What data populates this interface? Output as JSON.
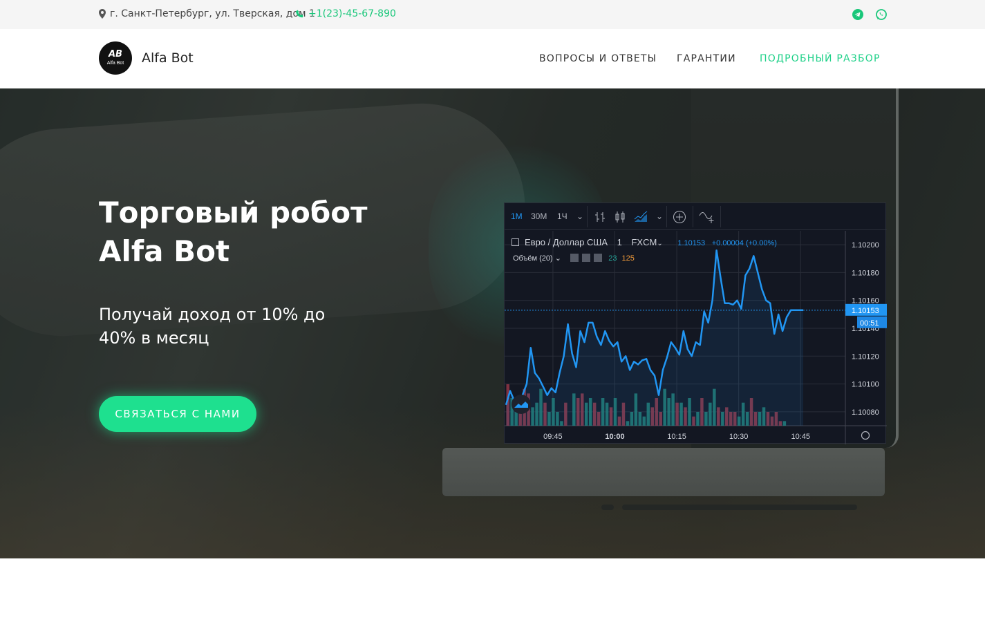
{
  "topbar": {
    "address": "г. Санкт-Петербург, ул. Тверская, дом 1",
    "phone": "+1(23)-45-67-890",
    "icons": [
      "location-pin-icon",
      "phone-icon",
      "telegram-icon",
      "whatsapp-icon"
    ]
  },
  "header": {
    "logo_mark": "AB",
    "logo_text": "Alfa Bot",
    "brand": "Alfa Bot",
    "nav": [
      {
        "label": "ВОПРОСЫ И ОТВЕТЫ",
        "active": false
      },
      {
        "label": "ГАРАНТИИ",
        "active": false
      },
      {
        "label": "ПОДРОБНЫЙ РАЗБОР",
        "active": true
      }
    ]
  },
  "hero": {
    "title_line1": "Торговый робот",
    "title_line2": "Alfa Bot",
    "subtitle": "Получай доход от 10% до 40% в месяц",
    "cta": "СВЯЗАТЬСЯ С НАМИ"
  },
  "colors": {
    "accent": "#1ee08f",
    "chart_line": "#2196f3",
    "chart_bg": "#131722"
  },
  "widget": {
    "timeframes": [
      "1М",
      "30М",
      "1Ч"
    ],
    "active_timeframe": "1М",
    "symbol": "Евро / Доллар США",
    "interval": "1",
    "exchange": "FXCM",
    "last_price": "1.10153",
    "change": "+0.00004 (+0.00%)",
    "volume_label": "Объём (20)",
    "volume_a": "23",
    "volume_b": "125",
    "price_tag": "1.10153",
    "timer_tag": "00:51"
  },
  "chart_data": {
    "type": "line",
    "ylim": [
      1.1007,
      1.1021
    ],
    "yticks": [
      "1.10200",
      "1.10180",
      "1.10160",
      "1.10140",
      "1.10120",
      "1.10100",
      "1.10080"
    ],
    "xticks": [
      "09:45",
      "10:00",
      "10:15",
      "10:30",
      "10:45"
    ],
    "bold_xtick": "10:00",
    "x": [
      0,
      1,
      2,
      3,
      4,
      5,
      6,
      7,
      8,
      9,
      10,
      11,
      12,
      13,
      14,
      15,
      16,
      17,
      18,
      19,
      20,
      21,
      22,
      23,
      24,
      25,
      26,
      27,
      28,
      29,
      30,
      31,
      32,
      33,
      34,
      35,
      36,
      37,
      38,
      39,
      40,
      41,
      42,
      43,
      44,
      45,
      46,
      47,
      48,
      49,
      50,
      51,
      52,
      53,
      54,
      55,
      56,
      57,
      58,
      59,
      60,
      61,
      62,
      63,
      64,
      65,
      66,
      67,
      68,
      69,
      70,
      71,
      72
    ],
    "series": [
      {
        "values": [
          1.10085,
          1.10095,
          1.10088,
          1.10082,
          1.10092,
          1.101,
          1.10126,
          1.10108,
          1.10104,
          1.10098,
          1.10092,
          1.10097,
          1.10094,
          1.10108,
          1.1012,
          1.10143,
          1.10122,
          1.10112,
          1.10138,
          1.1013,
          1.10144,
          1.10144,
          1.10134,
          1.10128,
          1.10138,
          1.10131,
          1.10127,
          1.1013,
          1.10116,
          1.1012,
          1.1011,
          1.10116,
          1.10114,
          1.10117,
          1.10118,
          1.1011,
          1.10106,
          1.10092,
          1.1011,
          1.10119,
          1.1013,
          1.10126,
          1.10121,
          1.10138,
          1.10125,
          1.1012,
          1.1013,
          1.10128,
          1.10152,
          1.10144,
          1.1016,
          1.10196,
          1.10176,
          1.10158,
          1.10158,
          1.10157,
          1.1016,
          1.10154,
          1.10178,
          1.10183,
          1.10192,
          1.1018,
          1.10168,
          1.1016,
          1.10158,
          1.10136,
          1.1015,
          1.10138,
          1.10148,
          1.10153,
          1.10153,
          1.10153,
          1.10153
        ],
        "up_volume": [
          0,
          6,
          3,
          0,
          0,
          1,
          4,
          5,
          8,
          1,
          3,
          6,
          3,
          1,
          4,
          0,
          7,
          2,
          3,
          5,
          6,
          2,
          1,
          6,
          5,
          0,
          6,
          0,
          3,
          1,
          3,
          7,
          3,
          2,
          5,
          0,
          0,
          0,
          8,
          6,
          7,
          0,
          5,
          0,
          6,
          0,
          3,
          0,
          3,
          5,
          8,
          0,
          3,
          0,
          0,
          0,
          2,
          5,
          3,
          0,
          0,
          3,
          4,
          0,
          0,
          0,
          0,
          1,
          0,
          0,
          0,
          0,
          0
        ],
        "down_volume": [
          9,
          3,
          0,
          4,
          8,
          7,
          0,
          4,
          0,
          5,
          3,
          0,
          0,
          0,
          5,
          0,
          0,
          6,
          7,
          0,
          0,
          5,
          3,
          0,
          0,
          4,
          0,
          2,
          5,
          0,
          2,
          0,
          0,
          2,
          0,
          4,
          6,
          3,
          0,
          0,
          0,
          5,
          0,
          4,
          0,
          2,
          0,
          6,
          0,
          0,
          0,
          4,
          0,
          4,
          3,
          3,
          0,
          0,
          0,
          6,
          3,
          0,
          0,
          3,
          2,
          3,
          1,
          0,
          0,
          0,
          0,
          0,
          0
        ]
      }
    ]
  }
}
